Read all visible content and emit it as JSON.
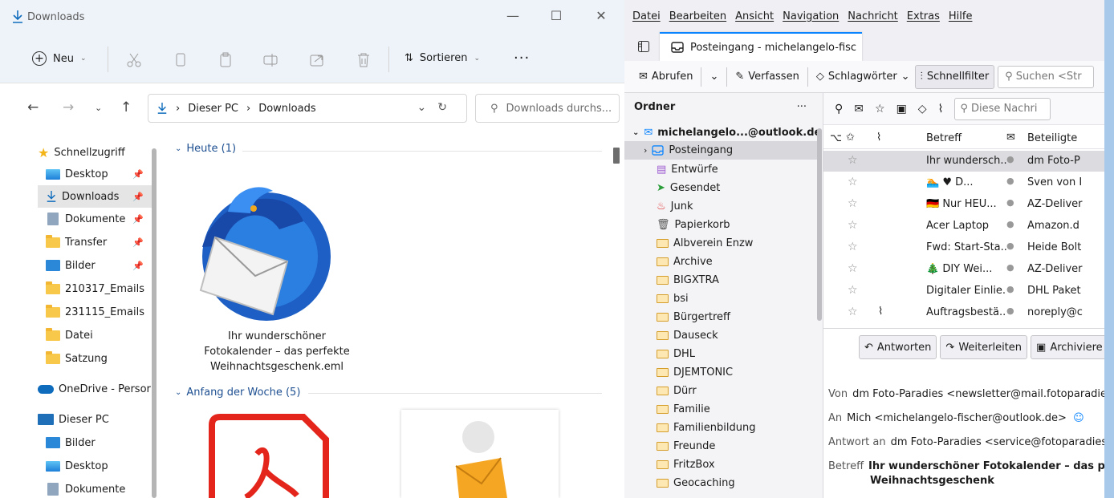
{
  "explorer": {
    "title": "Downloads",
    "toolbar": {
      "new_label": "Neu",
      "sort_label": "Sortieren",
      "more_label": "···"
    },
    "address": {
      "root": "Dieser PC",
      "current": "Downloads",
      "separator": "›"
    },
    "search_placeholder": "Downloads durchs...",
    "nav": {
      "quick_access": "Schnellzugriff",
      "items": [
        "Desktop",
        "Downloads",
        "Dokumente",
        "Transfer",
        "Bilder",
        "210317_Emails",
        "231115_Emails",
        "Datei",
        "Satzung"
      ],
      "onedrive": "OneDrive - Persor",
      "this_pc": "Dieser PC",
      "pc_items": [
        "Bilder",
        "Desktop",
        "Dokumente"
      ]
    },
    "groups": {
      "today": "Heute (1)",
      "week": "Anfang der Woche (5)"
    },
    "file_caption": [
      "Ihr wunderschöner",
      "Fotokalender – das perfekte",
      "Weihnachtsgeschenk.eml"
    ],
    "colors": {
      "accent": "#0f6cbd",
      "folder": "#f7c84a",
      "title_bg": "#eef3f9"
    }
  },
  "thunderbird": {
    "menu": [
      "Datei",
      "Bearbeiten",
      "Ansicht",
      "Navigation",
      "Nachricht",
      "Extras",
      "Hilfe"
    ],
    "tab_title": "Posteingang - michelangelo-fisc",
    "toolbar": {
      "fetch": "Abrufen",
      "compose": "Verfassen",
      "tags": "Schlagwörter",
      "quickfilter": "Schnellfilter",
      "search_placeholder": "Suchen <Str"
    },
    "folders_header": "Ordner",
    "folders_more": "···",
    "account": "michelangelo...@outlook.de",
    "folders": [
      "Posteingang",
      "Entwürfe",
      "Gesendet",
      "Junk",
      "Papierkorb",
      "Albverein Enzw",
      "Archive",
      "BIGXTRA",
      "bsi",
      "Bürgertreff",
      "Dauseck",
      "DHL",
      "DJEMTONIC",
      "Dürr",
      "Familie",
      "Familienbildung",
      "Freunde",
      "FritzBox",
      "Geocaching"
    ],
    "list": {
      "search_placeholder": "Diese Nachri",
      "headers": {
        "subject": "Betreff",
        "from": "Beteiligte"
      },
      "rows": [
        {
          "subject": "Ihr wundersch...",
          "from": "dm Foto-P"
        },
        {
          "subject": "🏊 ♥ D...",
          "from": "Sven von I"
        },
        {
          "subject": "🇩🇪 Nur HEU...",
          "from": "AZ-Deliver"
        },
        {
          "subject": "Acer Laptop",
          "from": "Amazon.d"
        },
        {
          "subject": "Fwd: Start-Sta...",
          "from": "Heide Bolt"
        },
        {
          "subject": "🎄 DIY Wei...",
          "from": "AZ-Deliver"
        },
        {
          "subject": "Digitaler Einlie...",
          "from": "DHL Paket"
        },
        {
          "subject": "Auftragsbestä...",
          "from": "noreply@c"
        }
      ]
    },
    "preview": {
      "reply": "Antworten",
      "forward": "Weiterleiten",
      "archive": "Archiviere",
      "from_label": "Von",
      "from_value": "dm Foto-Paradies <newsletter@mail.fotoparadie",
      "to_label": "An",
      "to_value": "Mich <michelangelo-fischer@outlook.de>",
      "replyto_label": "Antwort an",
      "replyto_value": "dm Foto-Paradies <service@fotoparadies",
      "subject_label": "Betreff",
      "subject_line1": "Ihr wunderschöner Fotokalender – das perf",
      "subject_line2": "Weihnachtsgeschenk"
    },
    "colors": {
      "accent": "#0a84ff",
      "selected": "#d8d8dc"
    }
  }
}
